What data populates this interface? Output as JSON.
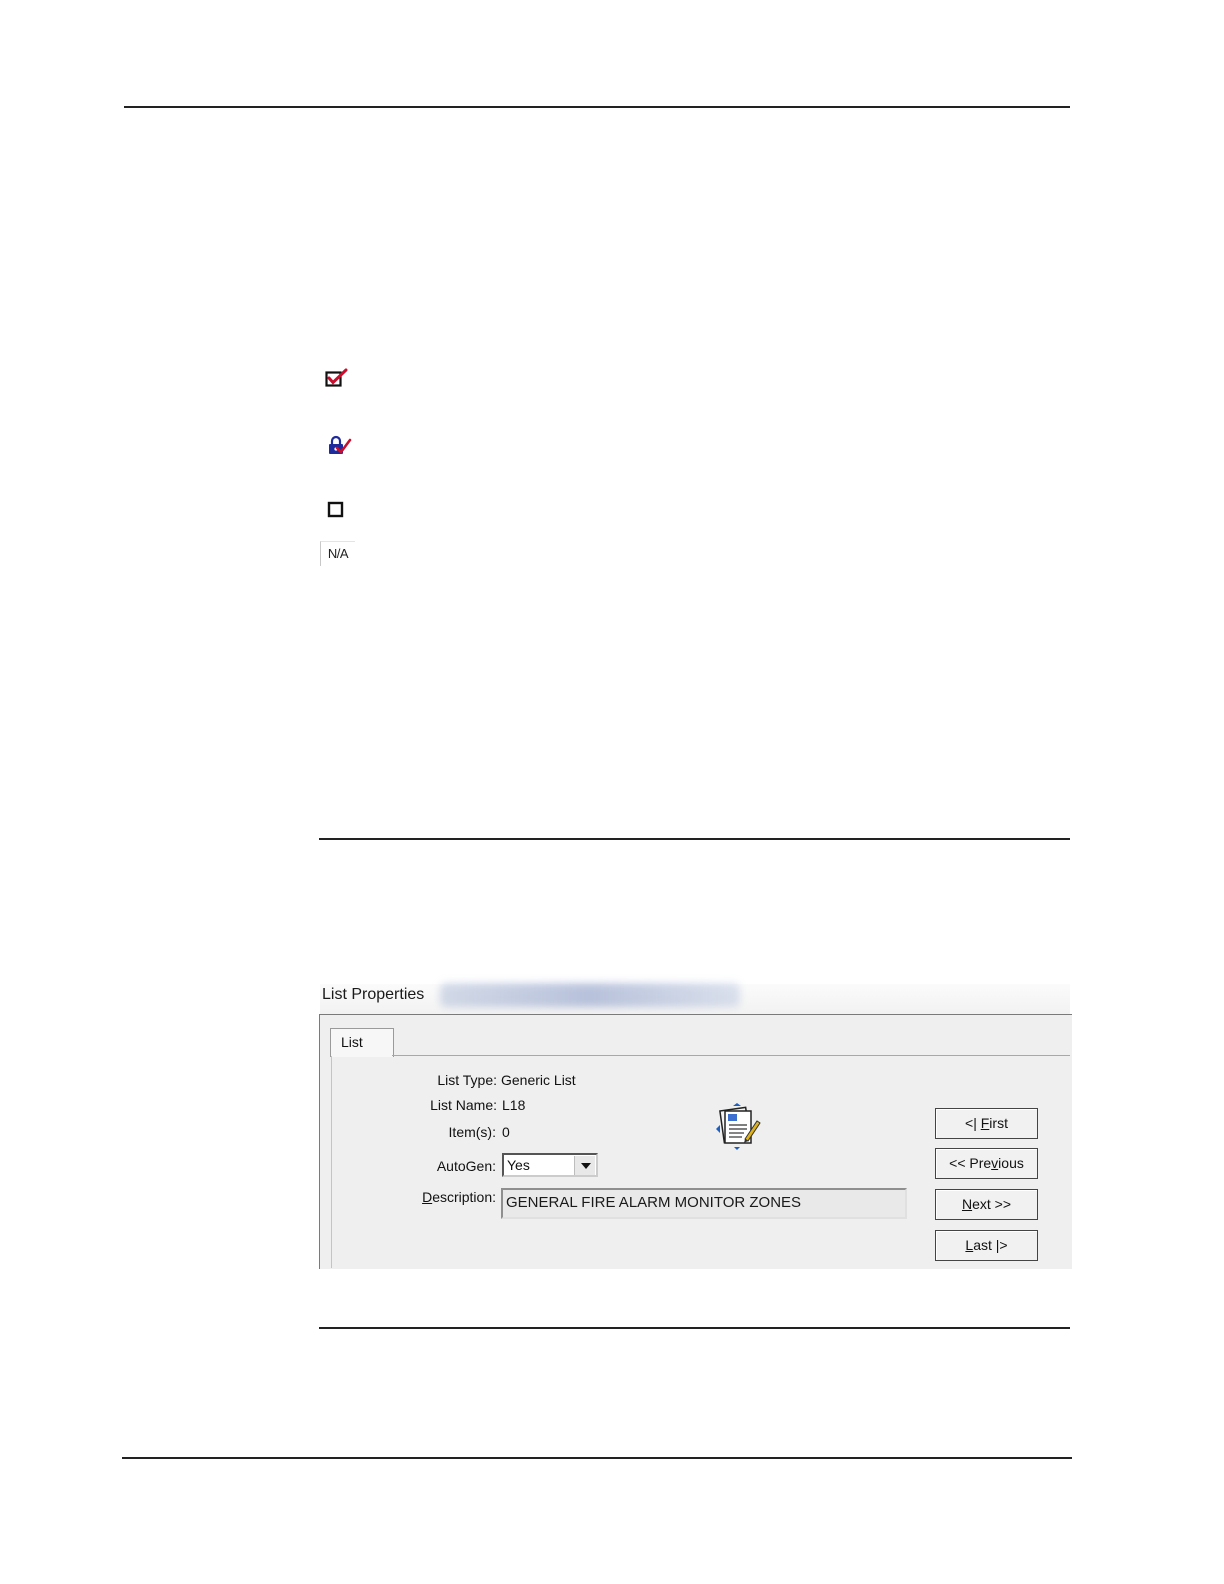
{
  "legend": {
    "na_text": "N/A"
  },
  "icons": {
    "checked": "checkbox-checked-red-icon",
    "locked": "lock-checked-icon",
    "unchecked": "checkbox-empty-icon",
    "list_properties": "list-properties-icon"
  },
  "dialog": {
    "title": "List Properties",
    "tab_label": "List",
    "fields": {
      "list_type_label": "List Type:",
      "list_type_value": "Generic List",
      "list_name_label": "List Name:",
      "list_name_value": "L18",
      "items_label": "Item(s):",
      "items_value": "0",
      "autogen_label": "AutoGen:",
      "autogen_value": "Yes",
      "description_label_first": "D",
      "description_label_rest": "escription:",
      "description_value": "GENERAL FIRE ALARM MONITOR ZONES"
    },
    "buttons": {
      "first_prefix": "<| ",
      "first_hot": "F",
      "first_rest": "irst",
      "previous_prefix": "<< Pre",
      "previous_hot": "v",
      "previous_rest": "ious",
      "next_hot": "N",
      "next_rest": "ext >>",
      "last_hot": "L",
      "last_rest": "ast |>"
    }
  },
  "colors": {
    "check_red": "#c8102e",
    "lock_blue": "#1f2a9c",
    "dialog_bg": "#efefef"
  }
}
